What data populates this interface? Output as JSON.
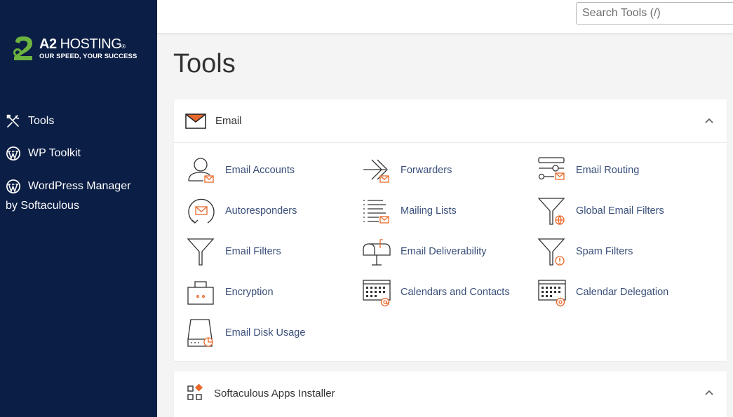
{
  "brand": {
    "name_bold": "A2",
    "name_rest": "HOSTING",
    "registered": "®",
    "tagline": "OUR SPEED, YOUR SUCCESS",
    "green": "#6cb33f"
  },
  "sidebar": {
    "items": [
      {
        "label": "Tools",
        "icon": "tools-icon"
      },
      {
        "label": "WP Toolkit",
        "icon": "wordpress-icon"
      },
      {
        "label": "WordPress Manager",
        "label2": "by Softaculous",
        "icon": "wordpress-icon"
      }
    ]
  },
  "search": {
    "placeholder": "Search Tools (/)",
    "value": ""
  },
  "page": {
    "title": "Tools"
  },
  "sections": {
    "email": {
      "title": "Email",
      "tools": [
        {
          "label": "Email Accounts"
        },
        {
          "label": "Forwarders"
        },
        {
          "label": "Email Routing"
        },
        {
          "label": "Autoresponders"
        },
        {
          "label": "Mailing Lists"
        },
        {
          "label": "Global Email Filters"
        },
        {
          "label": "Email Filters"
        },
        {
          "label": "Email Deliverability"
        },
        {
          "label": "Spam Filters"
        },
        {
          "label": "Encryption"
        },
        {
          "label": "Calendars and Contacts"
        },
        {
          "label": "Calendar Delegation"
        },
        {
          "label": "Email Disk Usage"
        }
      ]
    },
    "softaculous": {
      "title": "Softaculous Apps Installer"
    }
  },
  "colors": {
    "sidebar_bg": "#0b1e45",
    "accent_orange": "#e8692b",
    "link_blue": "#3a4f7a"
  }
}
